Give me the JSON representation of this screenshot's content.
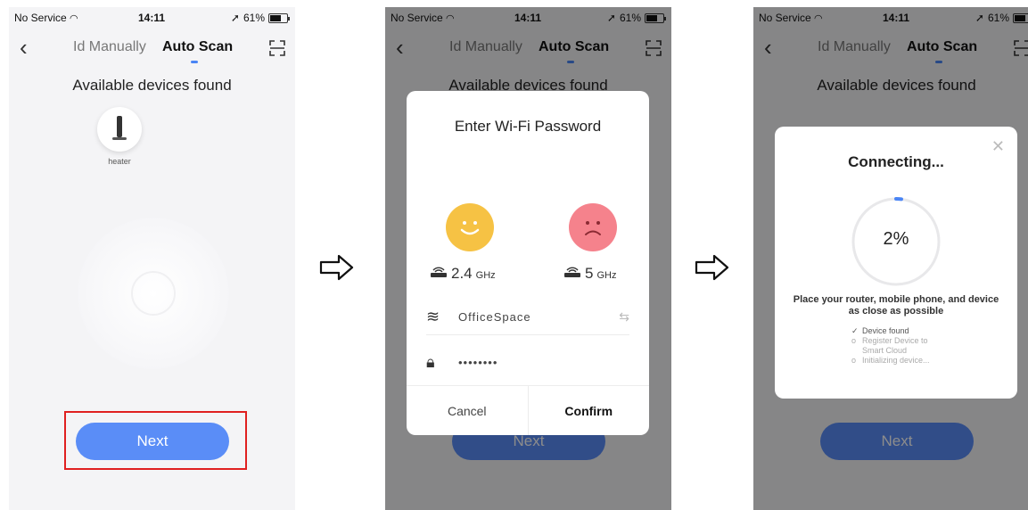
{
  "colors": {
    "accent": "#5a8df7",
    "highlight": "#e02020",
    "happy_face": "#f6c244",
    "sad_face": "#f5828c",
    "progress_arc": "#4a85f5"
  },
  "status_bar": {
    "carrier": "No Service",
    "time": "14:11",
    "battery": "61%"
  },
  "nav": {
    "back_icon": "chevron-left-icon",
    "tab_manual": "Id Manually",
    "tab_auto": "Auto Scan",
    "scan_icon": "scan-frame-icon"
  },
  "found_title": "Available devices found",
  "device": {
    "label": "heater",
    "icon": "heater-icon"
  },
  "next_label": "Next",
  "wifi_dialog": {
    "title": "Enter Wi-Fi Password",
    "band_24": {
      "value": "2.4",
      "unit": "GHz"
    },
    "band_5": {
      "value": "5",
      "unit": "GHz"
    },
    "ssid_value": "OfficeSpace",
    "password_value": "••••••••",
    "cancel_label": "Cancel",
    "confirm_label": "Confirm"
  },
  "connecting_dialog": {
    "title": "Connecting...",
    "progress_pct": "2%",
    "progress_fraction": 0.02,
    "hint": "Place your router, mobile phone, and device as close as possible",
    "steps": [
      {
        "mark": "✓",
        "label": "Device found"
      },
      {
        "mark": "o",
        "label": "Register Device to Smart Cloud"
      },
      {
        "mark": "o",
        "label": "Initializing device..."
      }
    ]
  }
}
